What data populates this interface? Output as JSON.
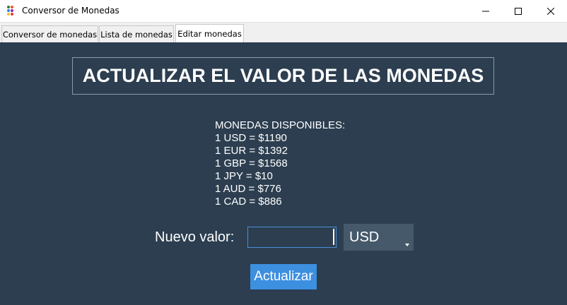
{
  "window": {
    "title": "Conversor de Monedas",
    "controls": [
      "minimize",
      "maximize",
      "close"
    ]
  },
  "tabs": [
    {
      "label": "Conversor de monedas",
      "active": false
    },
    {
      "label": "Lista de monedas",
      "active": false
    },
    {
      "label": "Editar monedas",
      "active": true
    }
  ],
  "main": {
    "heading": "ACTUALIZAR EL VALOR DE LAS MONEDAS",
    "available_title": "MONEDAS DISPONIBLES:",
    "rates": [
      "1 USD = $1190",
      "1 EUR = $1392",
      "1 GBP = $1568",
      "1 JPY = $10",
      "1 AUD = $776",
      "1 CAD = $886"
    ],
    "new_value_label": "Nuevo valor:",
    "new_value_input": "",
    "currency_select": "USD",
    "update_button": "Actualizar"
  },
  "colors": {
    "background": "#2c3e50",
    "button": "#3d8fe0",
    "select": "#46596b"
  }
}
